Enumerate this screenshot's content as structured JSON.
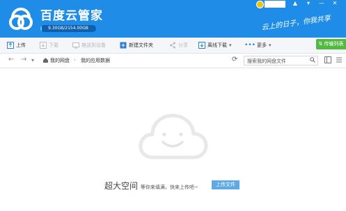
{
  "app": {
    "title": "百度云管家",
    "quota_text": "9.30GB/2154.00GB",
    "quota_used_fraction": 0.0043,
    "slogan": "云上的日子，你我共享",
    "accent": "#1f8de8"
  },
  "window_controls": [
    "▲",
    "—",
    "▾",
    "✕"
  ],
  "toolbar": {
    "upload": "上传",
    "download": "下载",
    "push": "推送到设备",
    "new_folder": "新建文件夹",
    "share": "分享",
    "offline_download": "离线下载",
    "more": "更多",
    "transfer_list": "传输列表"
  },
  "nav": {
    "back": "←",
    "forward": "→",
    "dropdown": "▾",
    "crumbs": [
      "我的网盘",
      "我的应用数据"
    ],
    "search_placeholder": "搜索我的网盘文件"
  },
  "empty": {
    "big": "超大空间",
    "small": "等你来填满，快来上传吧~",
    "upload_button": "上传文件"
  }
}
